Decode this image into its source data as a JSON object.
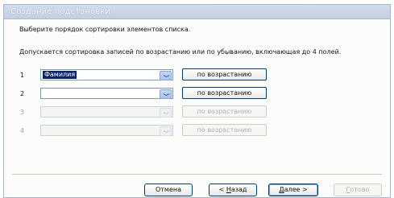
{
  "window": {
    "title": "Создание подстановки"
  },
  "instructions": {
    "line1": "Выберите порядок сортировки элементов списка.",
    "line2": "Допускается сортировка записей по возрастанию или по убыванию, включающая до 4 полей."
  },
  "sort_rows": [
    {
      "number": "1",
      "field": "Фамилия",
      "order": "по возрастанию",
      "enabled": true
    },
    {
      "number": "2",
      "field": "",
      "order": "по возрастанию",
      "enabled": true
    },
    {
      "number": "3",
      "field": "",
      "order": "по возрастанию",
      "enabled": false
    },
    {
      "number": "4",
      "field": "",
      "order": "по возрастанию",
      "enabled": false
    }
  ],
  "buttons": {
    "cancel": "Отмена",
    "back_prefix": "< ",
    "back_hotkey": "Н",
    "back_rest": "азад",
    "next_hotkey": "Д",
    "next_rest": "алее",
    "next_suffix": " >",
    "finish_hotkey": "Г",
    "finish_rest": "отово"
  },
  "icons": {
    "dropdown": "chevron-down-icon"
  }
}
